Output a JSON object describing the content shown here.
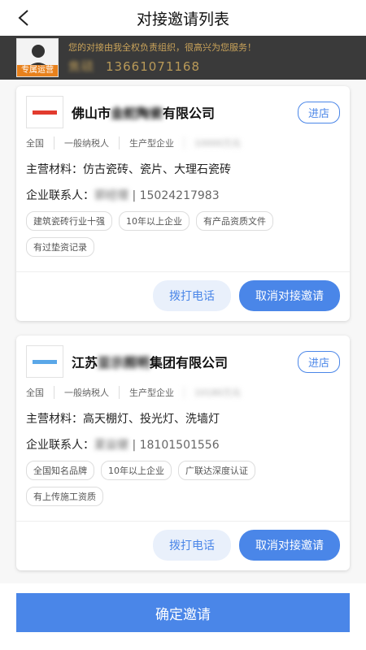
{
  "header": {
    "title": "对接邀请列表",
    "back_icon": "back-chevron-icon"
  },
  "banner": {
    "badge": "专属运营",
    "message": "您的对接由我全权负责组织，很高兴为您服务！",
    "contact_name": "焦硕",
    "contact_phone": "13661071168"
  },
  "cards": [
    {
      "company": {
        "prefix": "佛山市",
        "hidden": "金舵陶瓷",
        "suffix": "有限公司"
      },
      "logo_color": "#e23b2e",
      "store_label": "进店",
      "meta": [
        "全国",
        "一般纳税人",
        "生产型企业",
        "10000万元"
      ],
      "material_label": "主营材料：",
      "material_value": "仿古瓷砖、瓷片、大理石瓷砖",
      "contact_label": "企业联系人：",
      "contact_name": "郭经理",
      "contact_phone": "| 15024217983",
      "tags": [
        "建筑瓷砖行业十强",
        "10年以上企业",
        "有产品资质文件",
        "有过垫资记录"
      ],
      "call_label": "拨打电话",
      "cancel_label": "取消对接邀请"
    },
    {
      "company": {
        "prefix": "江苏",
        "hidden": "亚示照明",
        "suffix": "集团有限公司"
      },
      "logo_color": "#5aa7e8",
      "store_label": "进店",
      "meta": [
        "全国",
        "一般纳税人",
        "生产型企业",
        "10180万元"
      ],
      "material_label": "主营材料：",
      "material_value": "高天棚灯、投光灯、洗墙灯",
      "contact_label": "企业联系人：",
      "contact_name": "夏益健",
      "contact_phone": "| 18101501556",
      "tags": [
        "全国知名品牌",
        "10年以上企业",
        "广联达深度认证",
        "有上传施工资质"
      ],
      "call_label": "拨打电话",
      "cancel_label": "取消对接邀请"
    }
  ],
  "footer": {
    "confirm_label": "确定邀请"
  }
}
